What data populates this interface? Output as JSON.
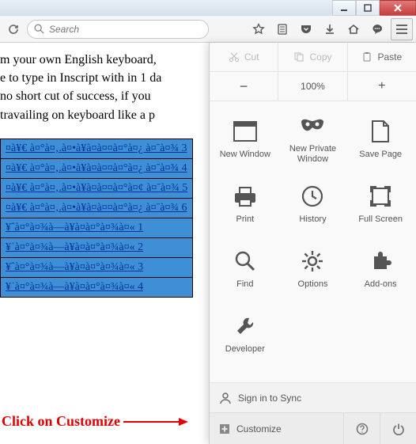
{
  "search": {
    "placeholder": "Search"
  },
  "toolbar": {
    "star": "★",
    "clipboard": "clipboard",
    "pocket": "pocket",
    "download": "download",
    "home": "home",
    "chat": "chat",
    "menu": "menu"
  },
  "content": {
    "para_l1": "m your own English keyboard,",
    "para_l2": "e to type in Inscript with in 1 da",
    "para_l3": "no short cut of success, if you ",
    "para_l4": " travailing on keyboard like a p",
    "table_rows": [
      "¤à¥€ à¤°à¤‚.à¤•à¥à¤à¤¤à¤°à¤¿ à¤ˉà¤¾ 3",
      "¤à¥€ à¤°à¤‚.à¤•à¥à¤à¤¤à¤°à¤¿ à¤ˉà¤¾ 4",
      "¤à¥€ à¤°à¤‚.à¤•à¥à¤à¤¤à¤°à¤¢ à¤ˉà¤¾ 5",
      "¤à¥€ à¤°à¤‚.à¤•à¥à¤à¤¤à¤°à¤¿ à¤ˉà¤¾ 6",
      "¥ˆà¤°à¤¾à—à¥à¤à¤°à¤¾à¤« 1",
      "¥ˈà¤°à¤¾à—à¥à¤à¤°à¤¾à¤« 2",
      "¥ˆà¤°à¤¾à—à¥à¤à¤°à¤¾à¤« 3",
      "¥ˈà¤°à¤¾à—à¥à¤à¤°à¤¾à¤« 4"
    ],
    "annotation": "Click on Customize"
  },
  "menu": {
    "edit": {
      "cut": "Cut",
      "copy": "Copy",
      "paste": "Paste"
    },
    "zoom": {
      "minus": "−",
      "level": "100%",
      "plus": "+"
    },
    "grid": [
      {
        "label": "New Window"
      },
      {
        "label": "New Private Window"
      },
      {
        "label": "Save Page"
      },
      {
        "label": "Print"
      },
      {
        "label": "History"
      },
      {
        "label": "Full Screen"
      },
      {
        "label": "Find"
      },
      {
        "label": "Options"
      },
      {
        "label": "Add-ons"
      },
      {
        "label": "Developer"
      }
    ],
    "sync": "Sign in to Sync",
    "customize": "Customize"
  }
}
